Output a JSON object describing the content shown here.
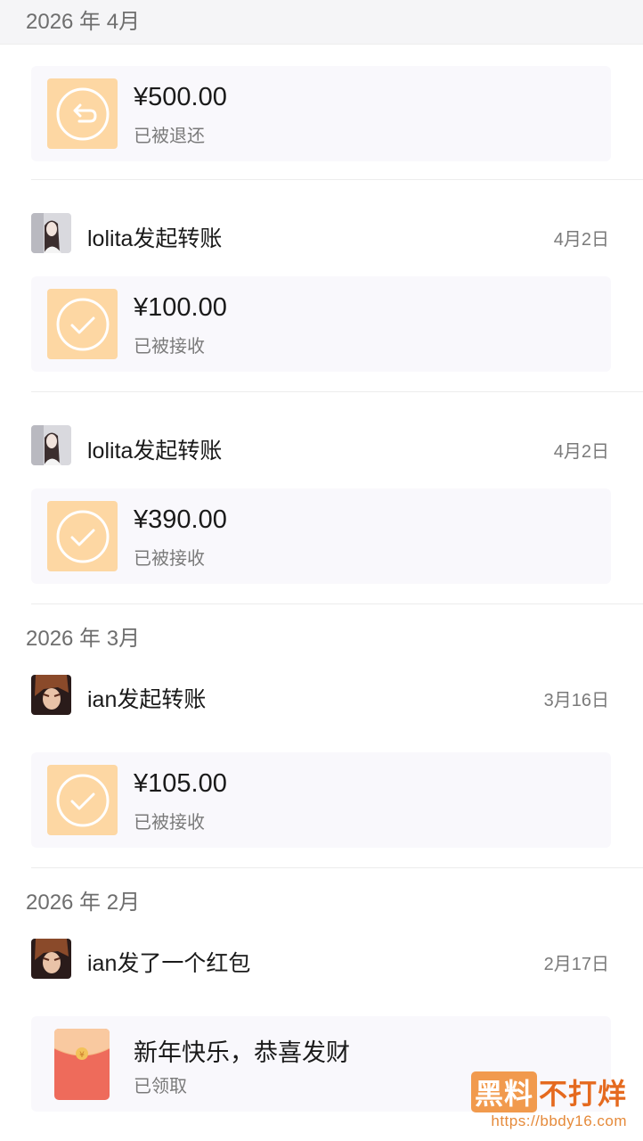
{
  "months": {
    "april": "2026 年 4月",
    "march": "2026 年 3月",
    "february": "2026 年 2月"
  },
  "entries": [
    {
      "amount": "¥500.00",
      "status": "已被退还",
      "icon": "refund-icon"
    },
    {
      "sender": "lolita发起转账",
      "date": "4月2日",
      "amount": "¥100.00",
      "status": "已被接收",
      "icon": "check-icon"
    },
    {
      "sender": "lolita发起转账",
      "date": "4月2日",
      "amount": "¥390.00",
      "status": "已被接收",
      "icon": "check-icon"
    },
    {
      "sender": "ian发起转账",
      "date": "3月16日",
      "amount": "¥105.00",
      "status": "已被接收",
      "icon": "check-icon"
    },
    {
      "sender": "ian发了一个红包",
      "date": "2月17日",
      "amount": "新年快乐，恭喜发财",
      "status": "已领取",
      "icon": "red-packet-icon"
    }
  ],
  "watermark": {
    "brand_box": "黑料",
    "brand_rest": "不打烊",
    "url": "https://bbdy16.com"
  },
  "colors": {
    "icon_bg": "#fdd7a3",
    "card_bg": "#f9f8fc",
    "red_packet": "#ee6b5b"
  }
}
